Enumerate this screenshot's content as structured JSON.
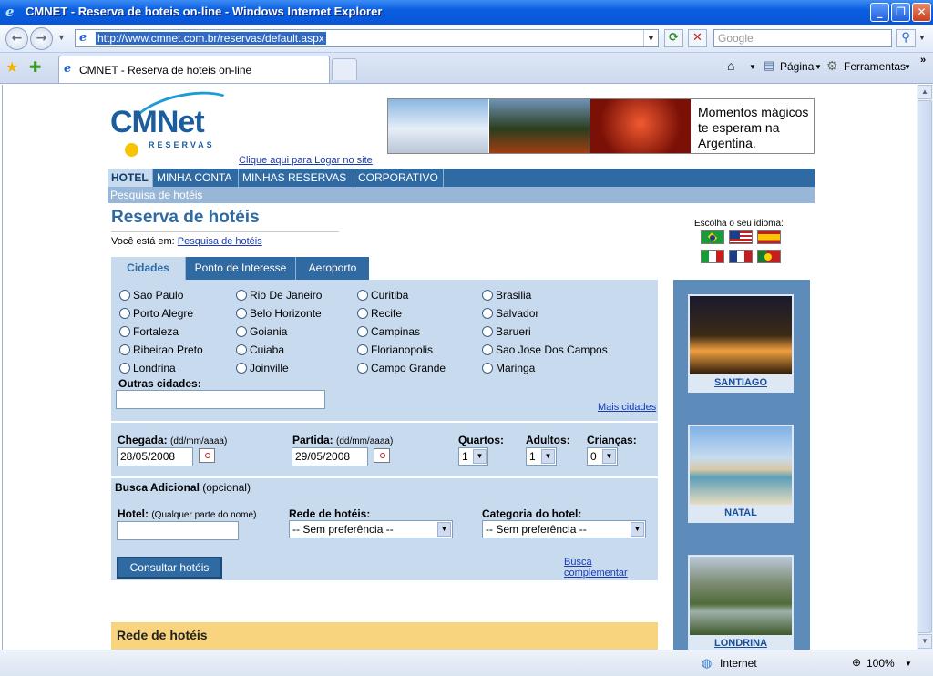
{
  "window": {
    "title": "CMNET - Reserva de hoteis on-line - Windows Internet Explorer",
    "minimize": "_",
    "maximize": "❐",
    "close": "✕"
  },
  "browser": {
    "url": "http://www.cmnet.com.br/reservas/default.aspx",
    "search_placeholder": "Google",
    "tab_title": "CMNET - Reserva de hoteis on-line",
    "page_menu": "Página",
    "tools_menu": "Ferramentas",
    "status_zone": "Internet",
    "zoom": "100%"
  },
  "header": {
    "logo_main": "CMNet",
    "logo_sub": "RESERVAS",
    "login_link": "Clique aqui para Logar no site",
    "banner_text": "Momentos mágicos te esperam na Argentina."
  },
  "nav": {
    "items": [
      {
        "label": "HOTEL"
      },
      {
        "label": "MINHA CONTA"
      },
      {
        "label": "MINHAS RESERVAS"
      },
      {
        "label": "CORPORATIVO"
      }
    ],
    "sub": "Pesquisa de hotéis"
  },
  "page": {
    "title": "Reserva de hotéis",
    "breadcrumb_prefix": "Você está em:",
    "breadcrumb_link": "Pesquisa de hotéis"
  },
  "language": {
    "title": "Escolha o seu idioma:"
  },
  "search_tabs": [
    {
      "label": "Cidades"
    },
    {
      "label": "Ponto de Interesse"
    },
    {
      "label": "Aeroporto"
    }
  ],
  "cities": [
    [
      "Sao Paulo",
      "Rio De Janeiro",
      "Curitiba",
      "Brasilia"
    ],
    [
      "Porto Alegre",
      "Belo Horizonte",
      "Recife",
      "Salvador"
    ],
    [
      "Fortaleza",
      "Goiania",
      "Campinas",
      "Barueri"
    ],
    [
      "Ribeirao Preto",
      "Cuiaba",
      "Florianopolis",
      "Sao Jose Dos Campos"
    ],
    [
      "Londrina",
      "Joinville",
      "Campo Grande",
      "Maringa"
    ]
  ],
  "form": {
    "other_cities_label": "Outras cidades:",
    "more_cities": "Mais cidades",
    "checkin_label": "Chegada:",
    "checkin_hint": "(dd/mm/aaaa)",
    "checkin_value": "28/05/2008",
    "checkout_label": "Partida:",
    "checkout_hint": "(dd/mm/aaaa)",
    "checkout_value": "29/05/2008",
    "rooms_label": "Quartos:",
    "rooms_value": "1",
    "adults_label": "Adultos:",
    "adults_value": "1",
    "children_label": "Crianças:",
    "children_value": "0",
    "extra_title": "Busca Adicional",
    "extra_optional": "(opcional)",
    "hotel_label": "Hotel:",
    "hotel_hint": "(Qualquer parte do nome)",
    "chain_label": "Rede de hotéis:",
    "chain_value": "-- Sem preferência --",
    "category_label": "Categoria do hotel:",
    "category_value": "-- Sem preferência --",
    "submit": "Consultar hotéis",
    "more_search": "Busca complementar"
  },
  "chains_box": {
    "title": "Rede de hotéis"
  },
  "sidebar": {
    "cities": [
      {
        "name": "SANTIAGO"
      },
      {
        "name": "NATAL"
      },
      {
        "name": "LONDRINA"
      }
    ]
  }
}
